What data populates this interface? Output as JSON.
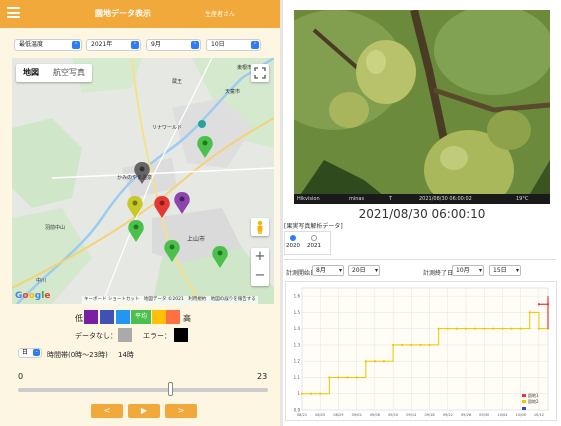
{
  "header": {
    "title": "園地データ表示",
    "user": "生産者さん"
  },
  "selectors": {
    "metric": "最低温度",
    "year": "2021年",
    "month": "9月",
    "day": "10日"
  },
  "map": {
    "tabs": [
      "地図",
      "航空写真"
    ],
    "active_tab": "地図",
    "labels": {
      "higashine": "東根市",
      "tendo": "天童市",
      "zao": "蔵王",
      "linewor": "リナワールド",
      "kaminoyama_onsen": "かみのやま温泉",
      "hanyu": "羽前中山",
      "kaminoyama_city": "上山市",
      "nakagawa": "中川"
    },
    "google": "Google",
    "attribution": "キーボード ショートカット　地図データ ©2021　利用規約　地図の誤りを報告する",
    "zoom_in": "+",
    "zoom_out": "−"
  },
  "legend": {
    "low": "低",
    "high": "高",
    "avg_label": "平均",
    "no_data": "データなし：",
    "error": "エラー：",
    "colors": {
      "purple": "#7b1fa2",
      "blue1": "#3f51b5",
      "blue2": "#2196f3",
      "green": "#4cc04c",
      "yellow": "#ffc107",
      "orange": "#ff7043",
      "red": "#e53935",
      "gray": "#aaaaaa",
      "black": "#000000"
    }
  },
  "time": {
    "unit": "日",
    "label": "時間帯(0時〜23時)",
    "hour_value": "14時",
    "min": "0",
    "max": "23",
    "slider_value": 14
  },
  "buttons": {
    "prev": "<",
    "play": "▶",
    "next": ">"
  },
  "photo": {
    "datetime": "2021/08/30 06:00:10",
    "bar_left": "Hikvision",
    "bar_mid1": "minas",
    "bar_mid2": "T",
    "bar_time": "2021/08/30 06:00:02",
    "bar_temp": "19°C"
  },
  "analysis": {
    "section_label": "[果実写真解析データ]",
    "years": [
      "2020",
      "2021"
    ],
    "start_label": "計測開始日:",
    "start_month": "8月",
    "start_day": "20日",
    "end_label": "計測終了日:",
    "end_month": "10月",
    "end_day": "15日"
  },
  "chart_data": {
    "type": "line",
    "x": [
      "08/21",
      "08/23",
      "08/25",
      "08/27",
      "08/29",
      "08/31",
      "09/02",
      "09/04",
      "09/06",
      "09/08",
      "09/10",
      "09/12",
      "09/14",
      "09/16",
      "09/18",
      "09/20",
      "09/22",
      "09/24",
      "09/26",
      "09/28",
      "09/30",
      "10/02",
      "10/04",
      "10/06",
      "10/08",
      "10/10",
      "10/12",
      "10/14"
    ],
    "xticks": [
      "08/21",
      "08/25",
      "08/29",
      "09/02",
      "09/06",
      "09/10",
      "09/14",
      "09/18",
      "09/22",
      "09/26",
      "09/30",
      "10/04",
      "10/08",
      "10/12"
    ],
    "ylim": [
      0.9,
      1.65
    ],
    "yticks": [
      "0.9",
      "1",
      "1.1",
      "1.2",
      "1.3",
      "1.4",
      "1.5",
      "1.6"
    ],
    "series": [
      {
        "name": "園地1",
        "color": "#e53935",
        "values": [
          null,
          null,
          null,
          null,
          null,
          null,
          null,
          null,
          null,
          null,
          null,
          null,
          null,
          null,
          null,
          null,
          null,
          null,
          null,
          null,
          null,
          null,
          null,
          null,
          null,
          null,
          1.55,
          1.55
        ]
      },
      {
        "name": "園地2",
        "color": "#f0c400",
        "values": [
          1.0,
          1.0,
          1.0,
          1.1,
          1.1,
          1.1,
          1.1,
          1.2,
          1.2,
          1.2,
          1.3,
          1.3,
          1.3,
          1.3,
          1.3,
          1.4,
          1.4,
          1.4,
          1.4,
          1.4,
          1.4,
          1.4,
          1.4,
          1.4,
          1.4,
          1.5,
          1.4,
          1.4
        ]
      }
    ],
    "legend": [
      "園地1",
      "園地2"
    ],
    "grid": true,
    "legend_position": "bottom-right"
  }
}
